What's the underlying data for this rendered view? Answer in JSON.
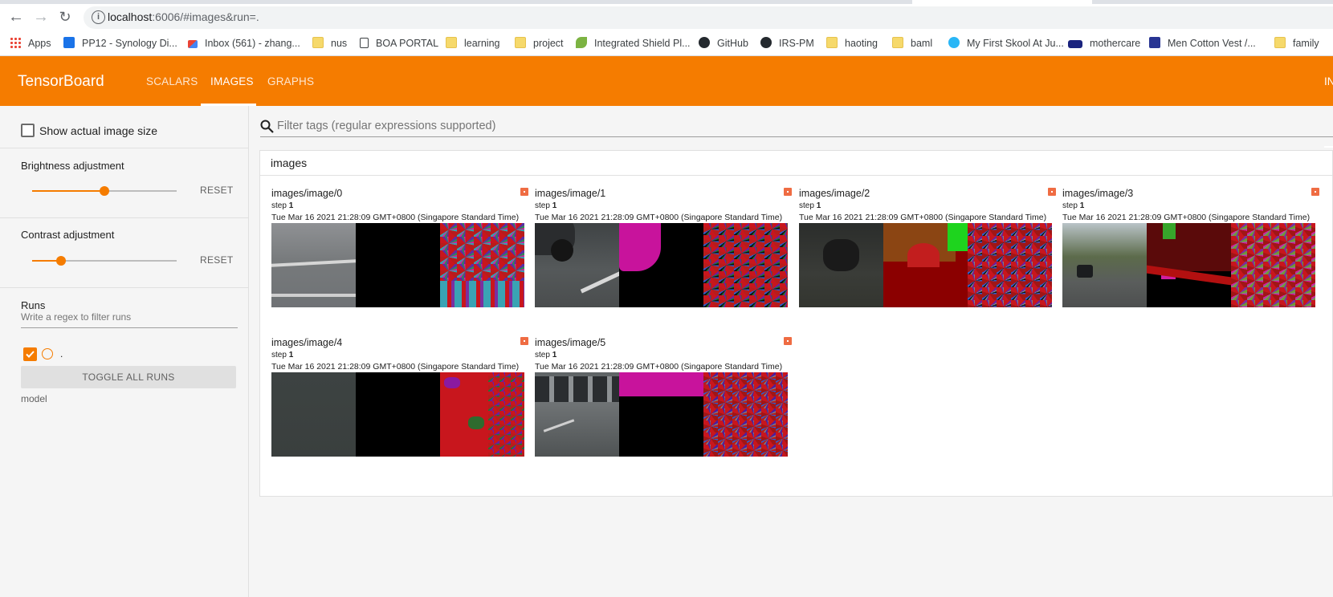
{
  "browser": {
    "url_host": "localhost",
    "url_path": ":6006/#images&run=.",
    "bookmarks": [
      {
        "label": "Apps",
        "icon": "apps-grid-icon"
      },
      {
        "label": "PP12 - Synology Di...",
        "icon": "synology-icon"
      },
      {
        "label": "Inbox (561) - zhang...",
        "icon": "gmail-icon"
      },
      {
        "label": "nus",
        "icon": "folder-icon"
      },
      {
        "label": "BOA PORTAL",
        "icon": "document-icon"
      },
      {
        "label": "learning",
        "icon": "folder-icon"
      },
      {
        "label": "project",
        "icon": "folder-icon"
      },
      {
        "label": "Integrated Shield Pl...",
        "icon": "leaf-icon"
      },
      {
        "label": "GitHub",
        "icon": "github-icon"
      },
      {
        "label": "IRS-PM",
        "icon": "github-icon"
      },
      {
        "label": "haoting",
        "icon": "folder-icon"
      },
      {
        "label": "baml",
        "icon": "folder-icon"
      },
      {
        "label": "My First Skool At Ju...",
        "icon": "globe-icon"
      },
      {
        "label": "mothercare",
        "icon": "mothercare-icon"
      },
      {
        "label": "Men Cotton Vest /...",
        "icon": "shop-icon"
      },
      {
        "label": "family",
        "icon": "folder-icon"
      }
    ]
  },
  "header": {
    "title": "TensorBoard",
    "tabs": [
      {
        "label": "SCALARS",
        "active": false
      },
      {
        "label": "IMAGES",
        "active": true
      },
      {
        "label": "GRAPHS",
        "active": false
      }
    ],
    "inactive_label": "IN",
    "brand_color": "#f57c00"
  },
  "sidebar": {
    "show_actual_size": "Show actual image size",
    "brightness": {
      "title": "Brightness adjustment",
      "reset": "RESET",
      "value": 0.5
    },
    "contrast": {
      "title": "Contrast adjustment",
      "reset": "RESET",
      "value": 0.2
    },
    "runs": {
      "title": "Runs",
      "filter_placeholder": "Write a regex to filter runs",
      "items": [
        {
          "name": ".",
          "checked": true
        }
      ],
      "toggle_all": "TOGGLE ALL RUNS",
      "group_label": "model"
    }
  },
  "main": {
    "search_placeholder": "Filter tags (regular expressions supported)",
    "panel_title": "images",
    "cards": [
      {
        "title": "images/image/0",
        "step_label": "step",
        "step": "1",
        "time": "Tue Mar 16 2021 21:28:09 GMT+0800 (Singapore Standard Time)"
      },
      {
        "title": "images/image/1",
        "step_label": "step",
        "step": "1",
        "time": "Tue Mar 16 2021 21:28:09 GMT+0800 (Singapore Standard Time)"
      },
      {
        "title": "images/image/2",
        "step_label": "step",
        "step": "1",
        "time": "Tue Mar 16 2021 21:28:09 GMT+0800 (Singapore Standard Time)"
      },
      {
        "title": "images/image/3",
        "step_label": "step",
        "step": "1",
        "time": "Tue Mar 16 2021 21:28:09 GMT+0800 (Singapore Standard Time)"
      },
      {
        "title": "images/image/4",
        "step_label": "step",
        "step": "1",
        "time": "Tue Mar 16 2021 21:28:09 GMT+0800 (Singapore Standard Time)"
      },
      {
        "title": "images/image/5",
        "step_label": "step",
        "step": "1",
        "time": "Tue Mar 16 2021 21:28:09 GMT+0800 (Singapore Standard Time)"
      }
    ]
  }
}
